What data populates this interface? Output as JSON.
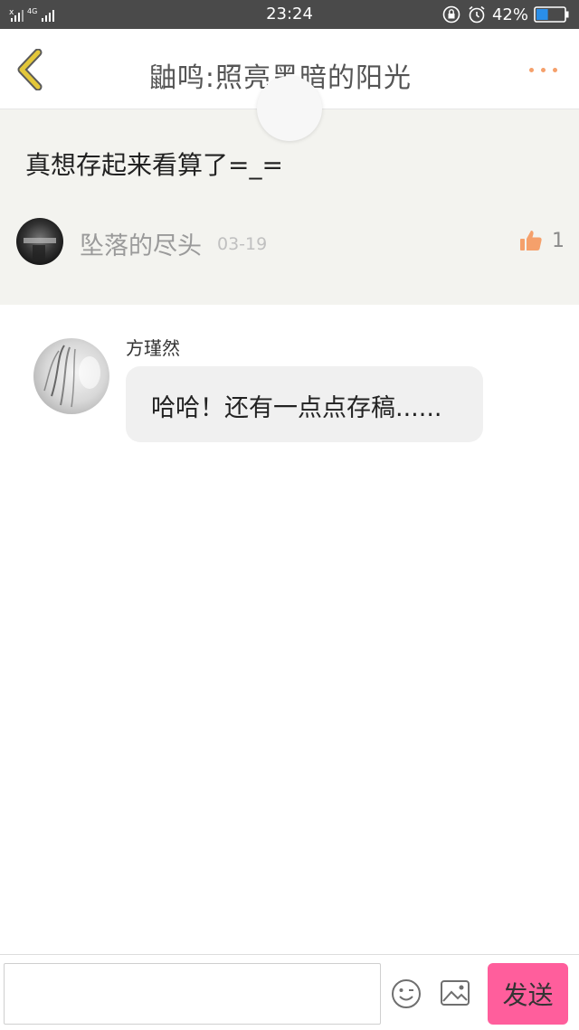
{
  "status_bar": {
    "time": "23:24",
    "network": "4G",
    "battery_percent": "42%",
    "battery_level": 0.42,
    "icons": [
      "signal-icon",
      "lock-rotation-icon",
      "alarm-icon",
      "battery-icon"
    ]
  },
  "header": {
    "title": "鼬鸣:照亮黑暗的阳光"
  },
  "post": {
    "text": "真想存起来看算了=_=",
    "author": "坠落的尽头",
    "date": "03-19",
    "likes": "1"
  },
  "reply": {
    "author": "方瑾然",
    "text": "哈哈！还有一点点存稿......"
  },
  "input": {
    "value": "",
    "placeholder": ""
  },
  "send_label": "发送",
  "colors": {
    "accent": "#f5a06b",
    "back_arrow": "#e3c73a",
    "send_button": "#ff5e9c",
    "post_background": "#f3f3ef",
    "bubble_background": "#f0f0f0"
  }
}
